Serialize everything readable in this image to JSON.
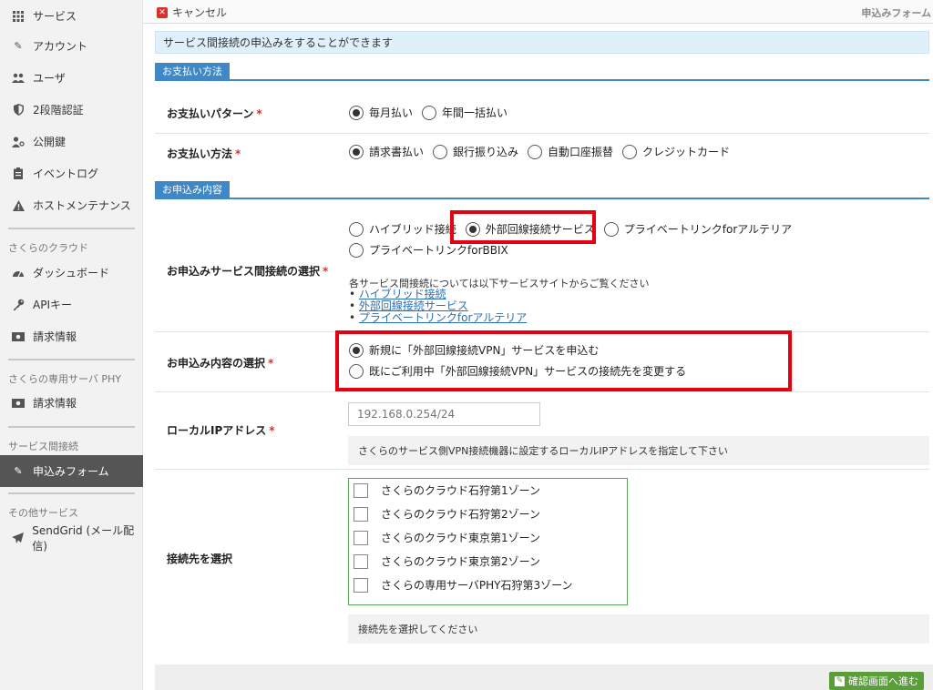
{
  "sidebar": {
    "items_top": [
      {
        "label": "サービス",
        "icon": "grid-icon"
      },
      {
        "label": "アカウント",
        "icon": "pencil-icon"
      },
      {
        "label": "ユーザ",
        "icon": "users-icon"
      },
      {
        "label": "2段階認証",
        "icon": "shield-icon"
      },
      {
        "label": "公開鍵",
        "icon": "key-user-icon"
      },
      {
        "label": "イベントログ",
        "icon": "clipboard-icon"
      },
      {
        "label": "ホストメンテナンス",
        "icon": "warning-icon"
      }
    ],
    "section_cloud": "さくらのクラウド",
    "items_cloud": [
      {
        "label": "ダッシュボード",
        "icon": "dashboard-icon"
      },
      {
        "label": "APIキー",
        "icon": "key-icon"
      },
      {
        "label": "請求情報",
        "icon": "billing-icon"
      }
    ],
    "section_phy": "さくらの専用サーバ PHY",
    "items_phy": [
      {
        "label": "請求情報",
        "icon": "billing-icon"
      }
    ],
    "section_interconnect": "サービス間接続",
    "items_interconnect": [
      {
        "label": "申込みフォーム",
        "icon": "pencil-icon",
        "active": true
      }
    ],
    "section_other": "その他サービス",
    "items_other": [
      {
        "label": "SendGrid (メール配信)",
        "icon": "paper-plane-icon"
      }
    ]
  },
  "topbar": {
    "cancel_label": "キャンセル",
    "page_title": "申込みフォーム"
  },
  "main": {
    "info_text": "サービス間接続の申込みをすることができます",
    "section_payment": "お支払い方法",
    "payment_pattern": {
      "label": "お支払いパターン",
      "required": "*",
      "options": [
        {
          "label": "毎月払い",
          "checked": true
        },
        {
          "label": "年間一括払い",
          "checked": false
        }
      ]
    },
    "payment_method": {
      "label": "お支払い方法",
      "required": "*",
      "options": [
        {
          "label": "請求書払い",
          "checked": true
        },
        {
          "label": "銀行振り込み",
          "checked": false
        },
        {
          "label": "自動口座振替",
          "checked": false
        },
        {
          "label": "クレジットカード",
          "checked": false
        }
      ]
    },
    "section_application": "お申込み内容",
    "service_select": {
      "label": "お申込みサービス間接続の選択",
      "required": "*",
      "options": [
        {
          "label": "ハイブリッド接続",
          "checked": false
        },
        {
          "label": "外部回線接続サービス",
          "checked": true
        },
        {
          "label": "プライベートリンクforアルテリア",
          "checked": false
        },
        {
          "label": "プライベートリンクforBBIX",
          "checked": false
        }
      ],
      "intro": "各サービス間接続については以下サービスサイトからご覧ください",
      "links": [
        "ハイブリッド接続",
        "外部回線接続サービス",
        "プライベートリンクforアルテリア"
      ]
    },
    "content_select": {
      "label": "お申込み内容の選択",
      "required": "*",
      "options": [
        {
          "label": "新規に「外部回線接続VPN」サービスを申込む",
          "checked": true
        },
        {
          "label": "既にご利用中「外部回線接続VPN」サービスの接続先を変更する",
          "checked": false
        }
      ]
    },
    "local_ip": {
      "label": "ローカルIPアドレス",
      "required": "*",
      "placeholder": "192.168.0.254/24",
      "help": "さくらのサービス側VPN接続機器に設定するローカルIPアドレスを指定して下さい"
    },
    "destination": {
      "label": "接続先を選択",
      "zones": [
        "さくらのクラウド石狩第1ゾーン",
        "さくらのクラウド石狩第2ゾーン",
        "さくらのクラウド東京第1ゾーン",
        "さくらのクラウド東京第2ゾーン",
        "さくらの専用サーバPHY石狩第3ゾーン"
      ],
      "help": "接続先を選択してください"
    },
    "confirm_label": "確認画面へ進む"
  },
  "colors": {
    "accent_blue": "#3f88c5",
    "highlight_red": "#e60012",
    "confirm_green": "#5a9e3a"
  }
}
